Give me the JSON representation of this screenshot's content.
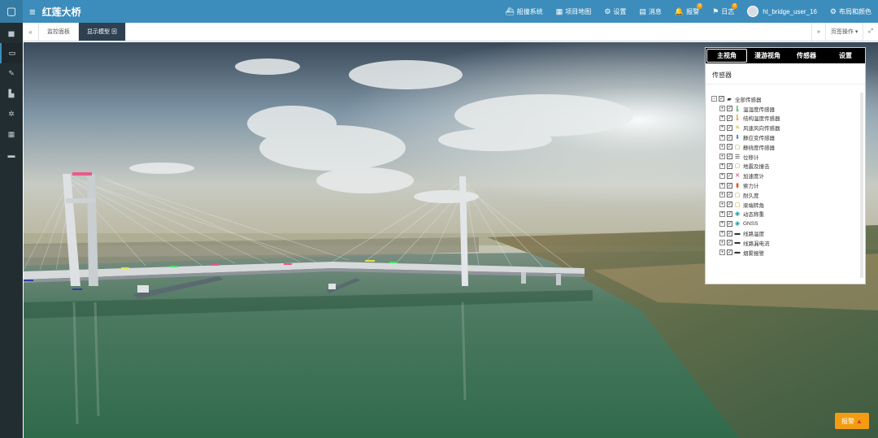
{
  "app": {
    "title": "红莲大桥"
  },
  "header": {
    "nav": [
      {
        "icon": "ship-icon",
        "glyph": "⛴",
        "label": "船撞系统"
      },
      {
        "icon": "map-icon",
        "glyph": "▦",
        "label": "项目地图"
      },
      {
        "icon": "cogs-icon",
        "glyph": "⚙",
        "label": "设置"
      },
      {
        "icon": "message-icon",
        "glyph": "▤",
        "label": "消息"
      },
      {
        "icon": "bell-icon",
        "glyph": "🔔",
        "label": "报警",
        "badge": "0"
      },
      {
        "icon": "flag-icon",
        "glyph": "⚑",
        "label": "日志",
        "badge": "0"
      }
    ],
    "username": "ht_bridge_user_16",
    "layout_label": "布局和颜色"
  },
  "sidebar": {
    "items": [
      {
        "icon": "area-chart-icon",
        "glyph": "▅"
      },
      {
        "icon": "laptop-icon",
        "glyph": "▭"
      },
      {
        "icon": "edit-icon",
        "glyph": "✎"
      },
      {
        "icon": "industry-icon",
        "glyph": "▙"
      },
      {
        "icon": "gear-icon",
        "glyph": "✲"
      },
      {
        "icon": "th-large-icon",
        "glyph": "▦"
      },
      {
        "icon": "credit-card-icon",
        "glyph": "▬"
      }
    ]
  },
  "tabs": {
    "items": [
      {
        "label": "监控面板"
      },
      {
        "label": "显示模型 ⊠"
      }
    ],
    "page_ops_label": "页签操作"
  },
  "panel": {
    "tabs": [
      "主视角",
      "漫游视角",
      "传感器",
      "设置"
    ],
    "title": "传感器",
    "root_label": "全部传感器",
    "sensors": [
      {
        "label": "温湿度传感器",
        "icon": "thermometer-icon",
        "glyph": "🌡",
        "color": "#2e9b4a"
      },
      {
        "label": "结构温度传感器",
        "icon": "temperature-icon",
        "glyph": "🌡",
        "color": "#e08a1c"
      },
      {
        "label": "风速风向传感器",
        "icon": "wind-icon",
        "glyph": "✳",
        "color": "#c9b400"
      },
      {
        "label": "静应变传感器",
        "icon": "strain-icon",
        "glyph": "⬇",
        "color": "#2f6fd6"
      },
      {
        "label": "静挠度传感器",
        "icon": "deflection-icon",
        "glyph": "▢",
        "color": "#7aa81c"
      },
      {
        "label": "位移计",
        "icon": "displacement-icon",
        "glyph": "☰",
        "color": "#222222"
      },
      {
        "label": "地震及撞击",
        "icon": "seismic-icon",
        "glyph": "▢",
        "color": "#b0a400"
      },
      {
        "label": "加速度计",
        "icon": "accelerometer-icon",
        "glyph": "✕",
        "color": "#d6286e"
      },
      {
        "label": "索力计",
        "icon": "cable-force-icon",
        "glyph": "▮",
        "color": "#e05522"
      },
      {
        "label": "耐久度",
        "icon": "durability-icon",
        "glyph": "▢",
        "color": "#b0a400"
      },
      {
        "label": "梁端转角",
        "icon": "rotation-icon",
        "glyph": "▢",
        "color": "#b0a400"
      },
      {
        "label": "动态称重",
        "icon": "weighing-icon",
        "glyph": "◉",
        "color": "#1aa0a0"
      },
      {
        "label": "GNSS",
        "icon": "gnss-icon",
        "glyph": "◉",
        "color": "#1aa0a0"
      },
      {
        "label": "线路温度",
        "icon": "folder-icon",
        "glyph": "▬",
        "color": "#333333"
      },
      {
        "label": "线路漏电流",
        "icon": "folder-icon",
        "glyph": "▬",
        "color": "#333333"
      },
      {
        "label": "烟雾报警",
        "icon": "folder-icon",
        "glyph": "▬",
        "color": "#333333"
      }
    ]
  },
  "alarm_button": {
    "label": "报警"
  }
}
